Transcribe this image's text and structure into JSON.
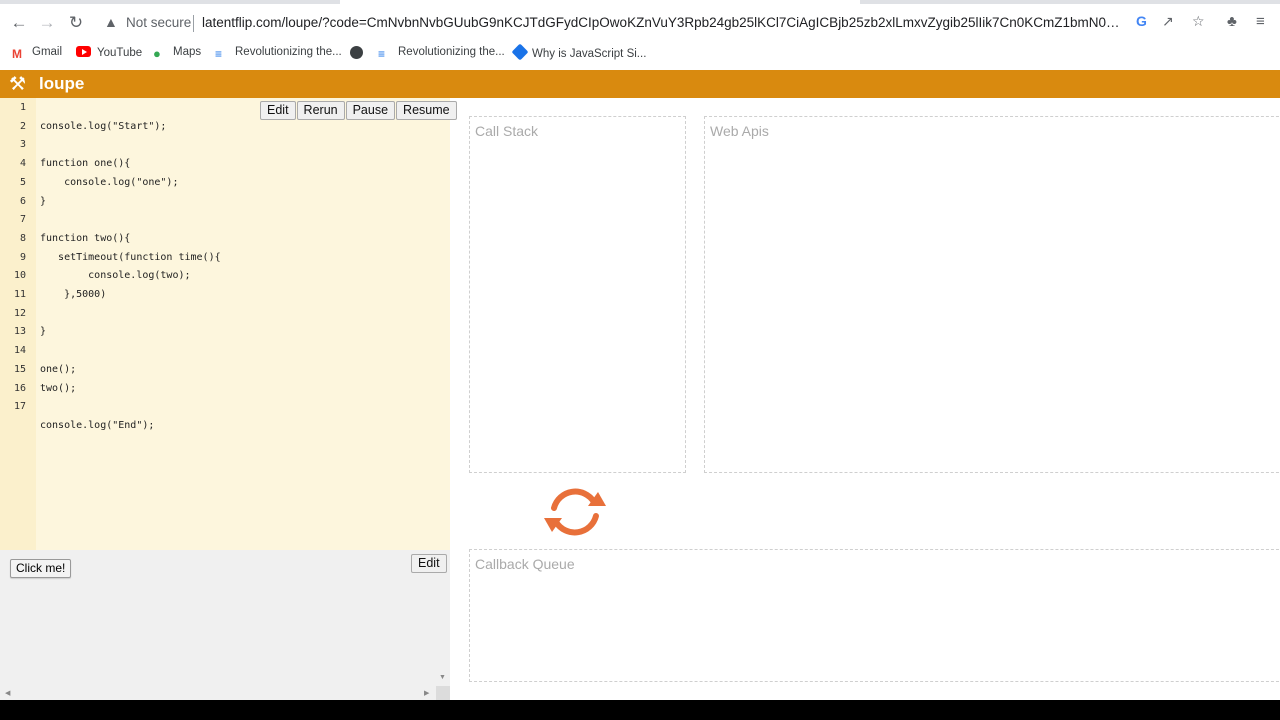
{
  "browser": {
    "security_label": "Not secure",
    "url": "latentflip.com/loupe/?code=CmNvbnNvbGUubG9nKCJTdGFydCIpOwoKZnVuY3Rpb24gb25lKCl7CiAgICBjb25zb2xlLmxvZygib25lIik7Cn0KCmZ1bmN0aW9uIHR3bygpew...",
    "bookmarks": [
      {
        "label": "Gmail",
        "icon": "gmail-icon"
      },
      {
        "label": "YouTube",
        "icon": "youtube-icon"
      },
      {
        "label": "Maps",
        "icon": "maps-icon"
      },
      {
        "label": "Revolutionizing the...",
        "icon": "bookmark-site-icon"
      },
      {
        "label": "",
        "icon": "globe-icon"
      },
      {
        "label": "Revolutionizing the...",
        "icon": "bookmark-site-icon"
      },
      {
        "label": "Why is JavaScript Si...",
        "icon": "diamond-icon"
      }
    ]
  },
  "app": {
    "title": "loupe",
    "logo_icon": "tools-icon",
    "accent_color": "#d98a0f"
  },
  "editor": {
    "buttons": {
      "edit": "Edit",
      "rerun": "Rerun",
      "pause": "Pause",
      "resume": "Resume"
    },
    "lines": [
      {
        "n": "1",
        "text": ""
      },
      {
        "n": "2",
        "text": "console.log(\"Start\");"
      },
      {
        "n": "3",
        "text": ""
      },
      {
        "n": "4",
        "text": "function one(){"
      },
      {
        "n": "5",
        "text": "    console.log(\"one\");"
      },
      {
        "n": "6",
        "text": "}"
      },
      {
        "n": "7",
        "text": ""
      },
      {
        "n": "8",
        "text": "function two(){"
      },
      {
        "n": "9",
        "text": "   setTimeout(function time(){"
      },
      {
        "n": "10",
        "text": "        console.log(two);"
      },
      {
        "n": "11",
        "text": "    },5000)"
      },
      {
        "n": "12",
        "text": ""
      },
      {
        "n": "13",
        "text": "}"
      },
      {
        "n": "14",
        "text": ""
      },
      {
        "n": "15",
        "text": "one();"
      },
      {
        "n": "16",
        "text": "two();"
      },
      {
        "n": "17",
        "text": ""
      },
      {
        "n": "",
        "text": "console.log(\"End\");"
      }
    ]
  },
  "output": {
    "click_button": "Click me!",
    "edit_button": "Edit"
  },
  "panels": {
    "call_stack": "Call Stack",
    "web_apis": "Web Apis",
    "callback_queue": "Callback Queue",
    "loop_icon": "event-loop-icon",
    "loop_color": "#e8703a"
  }
}
